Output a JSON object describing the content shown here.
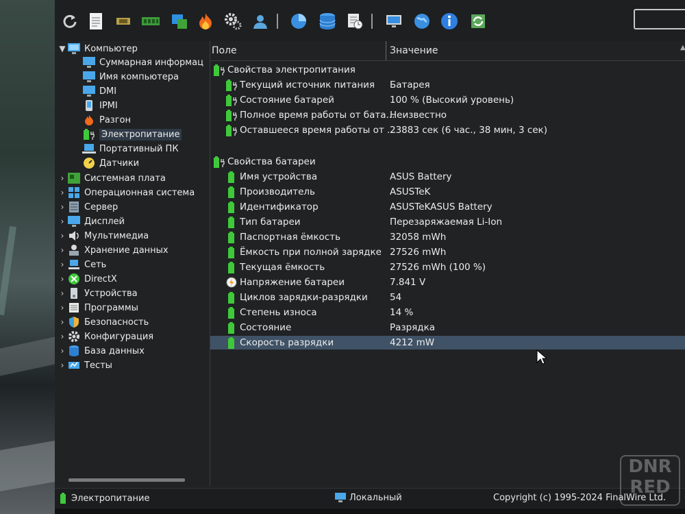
{
  "toolbar": {
    "icons": [
      "refresh-icon",
      "report-icon",
      "cpu-icon",
      "memory-icon",
      "motherboard-icon",
      "overclock-flame-icon",
      "settings-gears-icon",
      "user-icon",
      "disk-pie-icon",
      "database-icon",
      "schedule-icon",
      "network-monitor-icon",
      "globe-network-icon",
      "info-icon",
      "online-update-icon"
    ]
  },
  "tree": {
    "root": {
      "label": "Компьютер"
    },
    "children": [
      {
        "label": "Суммарная информац"
      },
      {
        "label": "Имя компьютера"
      },
      {
        "label": "DMI"
      },
      {
        "label": "IPMI"
      },
      {
        "label": "Разгон"
      },
      {
        "label": "Электропитание"
      },
      {
        "label": "Портативный ПК"
      },
      {
        "label": "Датчики"
      }
    ],
    "categories": [
      {
        "label": "Системная плата"
      },
      {
        "label": "Операционная система"
      },
      {
        "label": "Сервер"
      },
      {
        "label": "Дисплей"
      },
      {
        "label": "Мультимедиа"
      },
      {
        "label": "Хранение данных"
      },
      {
        "label": "Сеть"
      },
      {
        "label": "DirectX"
      },
      {
        "label": "Устройства"
      },
      {
        "label": "Программы"
      },
      {
        "label": "Безопасность"
      },
      {
        "label": "Конфигурация"
      },
      {
        "label": "База данных"
      },
      {
        "label": "Тесты"
      }
    ]
  },
  "table": {
    "col_field": "Поле",
    "col_value": "Значение",
    "group1": {
      "title": "Свойства электропитания",
      "rows": [
        {
          "field": "Текущий источник питания",
          "value": "Батарея"
        },
        {
          "field": "Состояние батарей",
          "value": "100 % (Высокий уровень)"
        },
        {
          "field": "Полное время работы от бата...",
          "value": "Неизвестно"
        },
        {
          "field": "Оставшееся время работы от ...",
          "value": "23883 сек (6 час., 38 мин, 3 сек)"
        }
      ]
    },
    "group2": {
      "title": "Свойства батареи",
      "rows": [
        {
          "field": "Имя устройства",
          "value": "ASUS Battery"
        },
        {
          "field": "Производитель",
          "value": "ASUSTeK"
        },
        {
          "field": "Идентификатор",
          "value": "ASUSTeKASUS Battery"
        },
        {
          "field": "Тип батареи",
          "value": "Перезаряжаемая Li-Ion"
        },
        {
          "field": "Паспортная ёмкость",
          "value": "32058 mWh"
        },
        {
          "field": "Ёмкость при полной зарядке",
          "value": "27526 mWh"
        },
        {
          "field": "Текущая ёмкость",
          "value": "27526 mWh  (100 %)"
        },
        {
          "field": "Напряжение батареи",
          "value": "7.841 V"
        },
        {
          "field": "Циклов зарядки-разрядки",
          "value": "54"
        },
        {
          "field": "Степень износа",
          "value": "14 %"
        },
        {
          "field": "Состояние",
          "value": "Разрядка"
        },
        {
          "field": "Скорость разрядки",
          "value": "4212 mW"
        }
      ]
    }
  },
  "status": {
    "left": "Электропитание",
    "middle": "Локальный",
    "right": "Copyright (c) 1995-2024 FinalWire Ltd."
  },
  "watermark": {
    "line1": "DNR",
    "line2": "RED"
  },
  "colors": {
    "highlight": "#3f5266",
    "battery_green": "#3fc93a",
    "accent_blue": "#2f8fe0"
  }
}
